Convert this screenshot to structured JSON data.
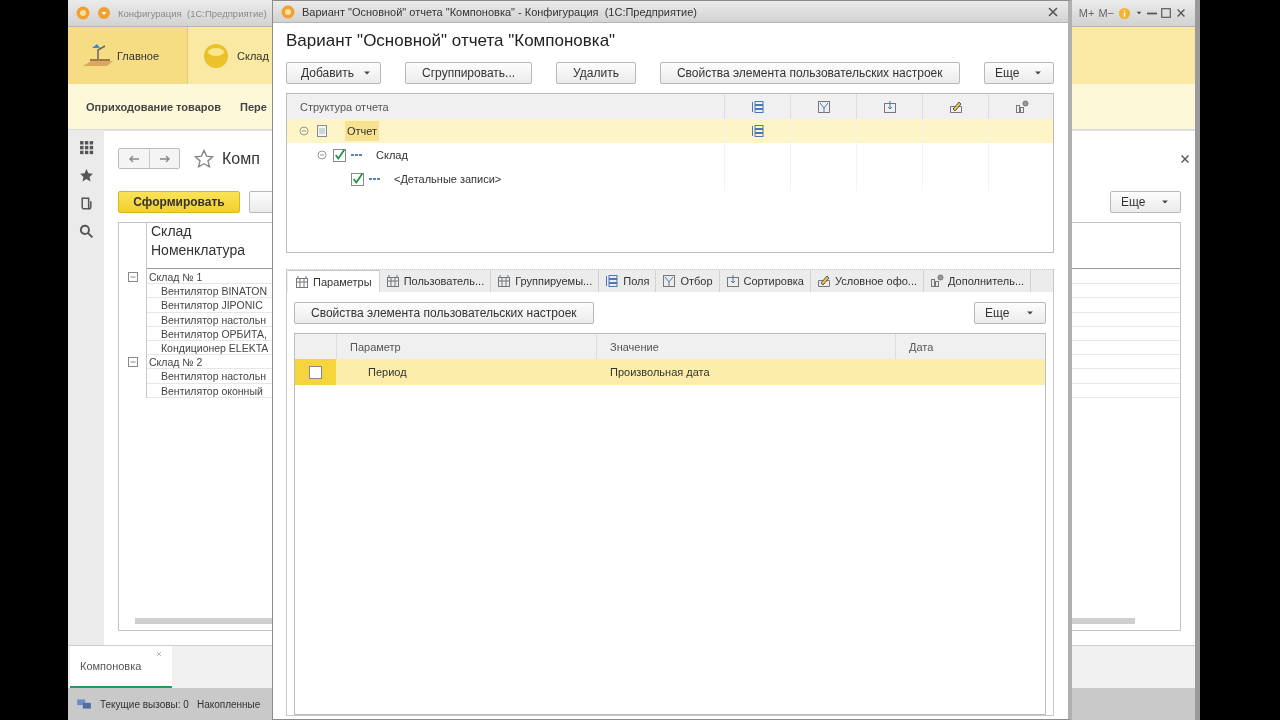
{
  "main_window": {
    "title": "Конфигурация  (1С:Предприятие)",
    "title_buttons": [
      "M+",
      "M−"
    ],
    "sections": [
      {
        "label": "Главное",
        "selected": true
      },
      {
        "label": "Склад",
        "selected": false
      }
    ],
    "subsections": [
      "Оприходование товаров",
      "Пере"
    ],
    "form": {
      "title": "Комп",
      "generate_button": "Сформировать",
      "more_button": "Еще",
      "report": {
        "headers": [
          "Склад",
          "Номенклатура"
        ],
        "groups": [
          {
            "label": "Склад № 1",
            "expanded": true,
            "items": [
              "Вентилятор BINATON",
              "Вентилятор JIPONIC",
              "Вентилятор настольн",
              "Вентилятор ОРБИТА,",
              "Кондиционер ELEKTA"
            ]
          },
          {
            "label": "Склад № 2",
            "expanded": true,
            "items": [
              "Вентилятор настольн",
              "Вентилятор оконный"
            ]
          }
        ]
      }
    },
    "open_windows": [
      {
        "label": "Компоновка",
        "selected": true
      }
    ],
    "status_bar": [
      "Текущие вызовы: 0",
      "Накопленные"
    ]
  },
  "dialog": {
    "title": "Вариант \"Основной\" отчета \"Компоновка\" - Конфигурация  (1С:Предприятие)",
    "heading": "Вариант \"Основной\" отчета \"Компоновка\"",
    "toolbar": [
      {
        "label": "Добавить",
        "dropdown": true
      },
      {
        "label": "Сгруппировать...",
        "dropdown": false
      },
      {
        "label": "Удалить",
        "dropdown": false
      },
      {
        "label": "Свойства элемента пользовательских настроек",
        "dropdown": false
      }
    ],
    "more_button": "Еще",
    "structure": {
      "column": "Структура отчета",
      "rows": [
        {
          "kind": "report",
          "label": "Отчет",
          "selected": true,
          "expanded": true,
          "children": [
            {
              "kind": "grouping",
              "label": "Склад",
              "selected": false,
              "expanded": true,
              "checked": true,
              "children": [
                {
                  "kind": "details",
                  "label": "<Детальные записи>",
                  "selected": false,
                  "checked": true
                }
              ]
            }
          ]
        }
      ]
    },
    "tabs": [
      {
        "label": "Параметры",
        "selected": true
      },
      {
        "label": "Пользователь...",
        "selected": false
      },
      {
        "label": "Группируемы...",
        "selected": false
      },
      {
        "label": "Поля",
        "selected": false
      },
      {
        "label": "Отбор",
        "selected": false
      },
      {
        "label": "Сортировка",
        "selected": false
      },
      {
        "label": "Условное офо...",
        "selected": false
      },
      {
        "label": "Дополнитель...",
        "selected": false
      }
    ],
    "tab_button": "Свойства элемента пользовательских настроек",
    "tab_more_button": "Еще",
    "parameters": {
      "columns": [
        "Параметр",
        "Значение",
        "Дата"
      ],
      "rows": [
        {
          "checked": false,
          "selected": true,
          "parameter": "Период",
          "value": "Произвольная дата"
        }
      ]
    }
  }
}
